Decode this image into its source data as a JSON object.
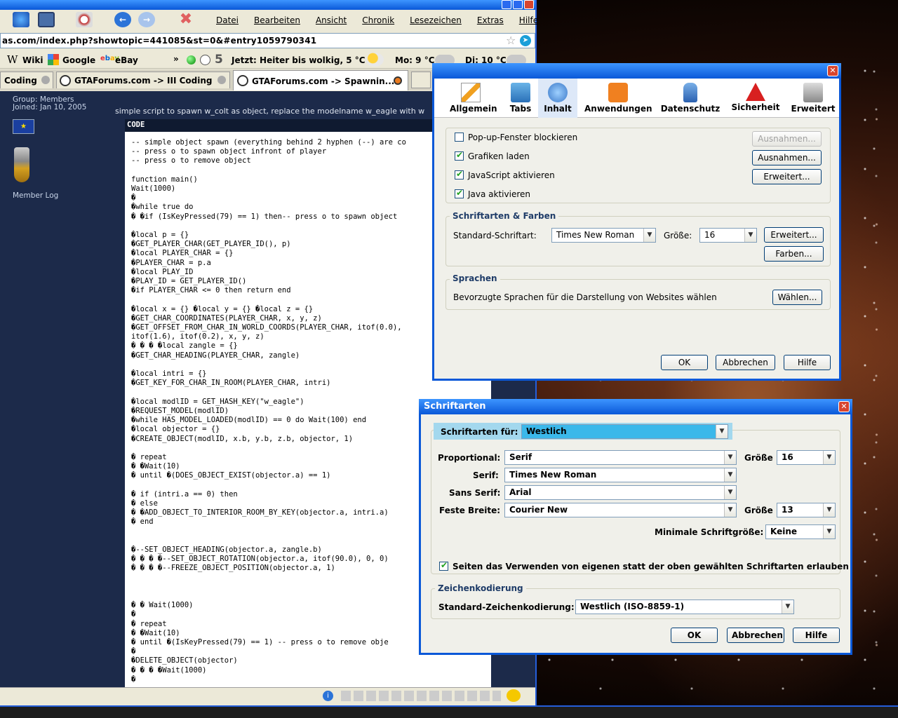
{
  "browser": {
    "menu": [
      "Datei",
      "Bearbeiten",
      "Ansicht",
      "Chronik",
      "Lesezeichen",
      "Extras",
      "Hilfe"
    ],
    "url": "as.com/index.php?showtopic=441085&st=0&#entry1059790341",
    "bookmarks": [
      "Wiki",
      "Google",
      "eBay"
    ],
    "bookmarks_more": "»",
    "weather_count": "5",
    "weather_now": "Jetzt: Heiter bis wolkig, 5 °C",
    "weather_mo": "Mo: 9 °C",
    "weather_di": "Di: 10 °C",
    "tabs": [
      "Coding",
      "GTAForums.com -> III Coding",
      "GTAForums.com -> Spawnin..."
    ]
  },
  "forum": {
    "group": "Group: Members",
    "joined": "Joined: Jan 10, 2005",
    "member_log": "Member Log",
    "post_text": "simple script to spawn w_colt as object, replace the modelname w_eagle with w",
    "code_header": "CODE",
    "code_lines": [
      "-- simple object spawn (everything behind 2 hyphen (--) are co",
      "-- press o to spawn object infront of player",
      "-- press o to remove object",
      "",
      "function main()",
      "Wait(1000)",
      "�",
      "�while true do",
      "� �if (IsKeyPressed(79) == 1) then-- press o to spawn object",
      "",
      "�local p = {}",
      "�GET_PLAYER_CHAR(GET_PLAYER_ID(), p)",
      "�local PLAYER_CHAR = {}",
      "�PLAYER_CHAR = p.a",
      "�local PLAY_ID",
      "�PLAY_ID = GET_PLAYER_ID()",
      "�if PLAYER_CHAR <= 0 then return end",
      "",
      "�local x = {} �local y = {} �local z = {}",
      "�GET_CHAR_COORDINATES(PLAYER_CHAR, x, y, z)",
      "�GET_OFFSET_FROM_CHAR_IN_WORLD_COORDS(PLAYER_CHAR, itof(0.0),",
      "itof(1.6), itof(0.2), x, y, z)",
      "� � � �local zangle = {}",
      "�GET_CHAR_HEADING(PLAYER_CHAR, zangle)",
      "",
      "�local intri = {}",
      "�GET_KEY_FOR_CHAR_IN_ROOM(PLAYER_CHAR, intri)",
      "",
      "�local modlID = GET_HASH_KEY(\"w_eagle\")",
      "�REQUEST_MODEL(modlID)",
      "�while HAS_MODEL_LOADED(modlID) == 0 do Wait(100) end",
      "�local objector = {}",
      "�CREATE_OBJECT(modlID, x.b, y.b, z.b, objector, 1)",
      "",
      "� repeat",
      "� �Wait(10)",
      "� until �(DOES_OBJECT_EXIST(objector.a) == 1)",
      "",
      "� if (intri.a == 0) then",
      "� else",
      "� �ADD_OBJECT_TO_INTERIOR_ROOM_BY_KEY(objector.a, intri.a)",
      "� end",
      "",
      "",
      "�--SET_OBJECT_HEADING(objector.a, zangle.b)",
      "� � � �--SET_OBJECT_ROTATION(objector.a, itof(90.0), 0, 0)",
      "� � � �--FREEZE_OBJECT_POSITION(objector.a, 1)",
      "",
      "",
      "",
      "� � Wait(1000)",
      "�",
      "� repeat",
      "� �Wait(10)",
      "� until �(IsKeyPressed(79) == 1) -- press o to remove obje",
      "�",
      "�DELETE_OBJECT(objector)",
      "� � � �Wait(1000)",
      "�"
    ]
  },
  "prefs": {
    "tabs": [
      "Allgemein",
      "Tabs",
      "Inhalt",
      "Anwendungen",
      "Datenschutz",
      "Sicherheit",
      "Erweitert"
    ],
    "active_tab": "Inhalt",
    "popup_label": "Pop-up-Fenster blockieren",
    "images_label": "Grafiken laden",
    "js_label": "JavaScript aktivieren",
    "java_label": "Java aktivieren",
    "exceptions_btn": "Ausnahmen...",
    "advanced_btn": "Erweitert...",
    "fonts_group": "Schriftarten & Farben",
    "default_font_label": "Standard-Schriftart:",
    "default_font": "Times New Roman",
    "size_label": "Größe:",
    "size": "16",
    "colors_btn": "Farben...",
    "lang_group": "Sprachen",
    "lang_text": "Bevorzugte Sprachen für die Darstellung von Websites wählen",
    "choose_btn": "Wählen...",
    "ok": "OK",
    "cancel": "Abbrechen",
    "help": "Hilfe"
  },
  "fonts": {
    "title": "Schriftarten",
    "for_label": "Schriftarten für:",
    "for_value": "Westlich",
    "proportional_label": "Proportional:",
    "proportional": "Serif",
    "size_label": "Größe",
    "prop_size": "16",
    "serif_label": "Serif:",
    "serif": "Times New Roman",
    "sans_label": "Sans Serif:",
    "sans": "Arial",
    "mono_label": "Feste Breite:",
    "mono": "Courier New",
    "mono_size": "13",
    "min_size_label": "Minimale Schriftgröße:",
    "min_size": "Keine",
    "allow_label": "Seiten das Verwenden von eigenen statt der oben gewählten Schriftarten erlauben",
    "encoding_group": "Zeichenkodierung",
    "encoding_label": "Standard-Zeichenkodierung:",
    "encoding": "Westlich (ISO-8859-1)",
    "ok": "OK",
    "cancel": "Abbrechen",
    "help": "Hilfe"
  },
  "colors": {
    "xp_title": "#0a58d8",
    "forum_bg": "#1c2a4a",
    "accent": "#3bb8ea"
  }
}
